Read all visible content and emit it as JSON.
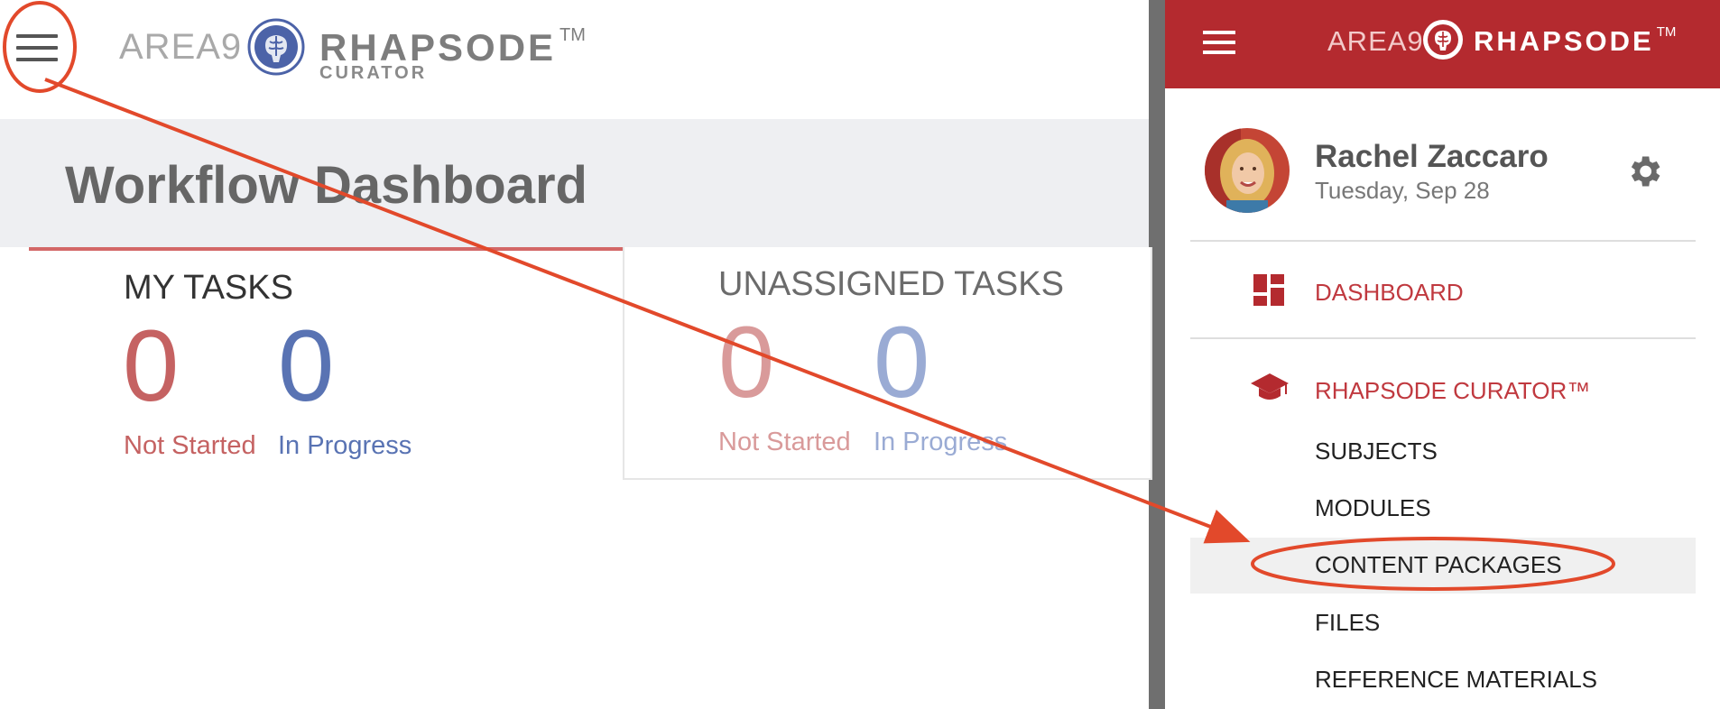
{
  "left": {
    "logo": {
      "area9": "AREA9",
      "rhapsode": "RHAPSODE",
      "tm": "TM",
      "curator": "CURATOR"
    },
    "dashboard_title": "Workflow Dashboard",
    "my_tasks": {
      "title": "MY TASKS",
      "not_started_count": "0",
      "in_progress_count": "0",
      "not_started_label": "Not Started",
      "in_progress_label": "In Progress"
    },
    "unassigned_tasks": {
      "title": "UNASSIGNED TASKS",
      "not_started_count": "0",
      "in_progress_count": "0",
      "not_started_label": "Not Started",
      "in_progress_label": "In Progress"
    }
  },
  "right": {
    "logo": {
      "area9": "AREA9",
      "rhapsode": "RHAPSODE",
      "tm": "TM"
    },
    "user": {
      "name": "Rachel Zaccaro",
      "date": "Tuesday, Sep 28"
    },
    "nav": {
      "dashboard": "DASHBOARD",
      "curator": "RHAPSODE CURATOR™",
      "subjects": "SUBJECTS",
      "modules": "MODULES",
      "content_packages": "CONTENT PACKAGES",
      "files": "FILES",
      "reference_materials": "REFERENCE MATERIALS"
    }
  },
  "colors": {
    "brand_red": "#b42a2f",
    "nav_red": "#c0393f",
    "not_started": "#c56262",
    "in_progress": "#5973b3",
    "annotation": "#e2492b"
  },
  "icons": [
    "menu-icon",
    "brain-logo-icon",
    "dashboard-icon",
    "graduation-cap-icon",
    "gear-icon"
  ]
}
